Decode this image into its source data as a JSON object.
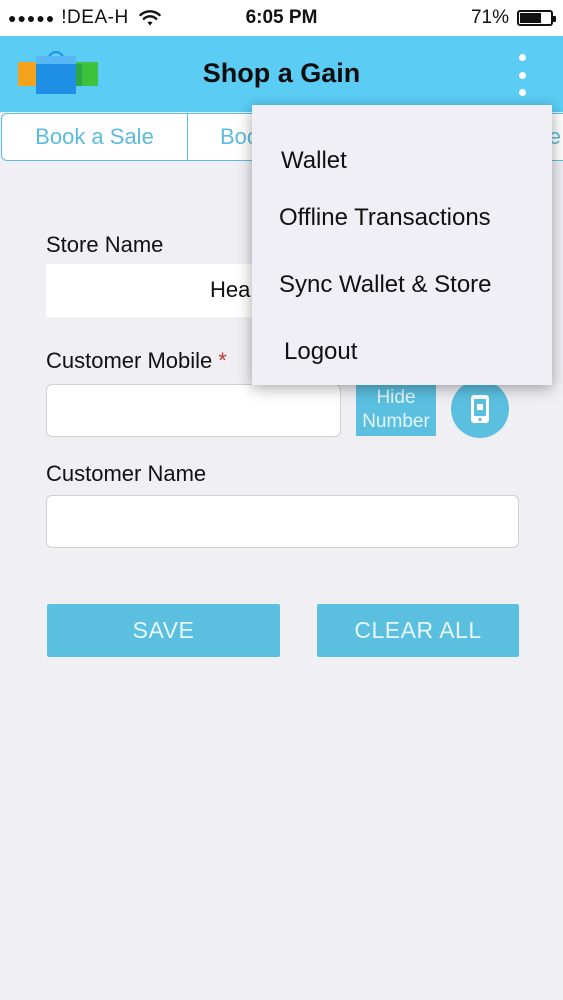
{
  "status_bar": {
    "signal_dots": "●●●●●",
    "carrier": "!DEA-H",
    "wifi_icon": "wifi-icon",
    "time": "6:05 PM",
    "battery_percent": "71%",
    "battery_level": 0.71
  },
  "app_bar": {
    "title": "Shop a Gain",
    "logo_icon": "shopping-bags-logo",
    "menu_icon": "more-vertical-icon"
  },
  "tabs": [
    {
      "label": "Book a Sale"
    },
    {
      "label": "Boo"
    },
    {
      "label": "e"
    }
  ],
  "form": {
    "store_name_label": "Store Name",
    "store_name_value": "Hea",
    "customer_mobile_label": "Customer Mobile",
    "required_mark": "*",
    "customer_mobile_value": "",
    "hide_number_label_line1": "Hide",
    "hide_number_label_line2": "Number",
    "contact_icon": "contact-phone-icon",
    "customer_name_label": "Customer Name",
    "customer_name_value": "",
    "save_label": "SAVE",
    "clear_all_label": "CLEAR ALL"
  },
  "overflow_menu": {
    "items": [
      {
        "label": "Wallet"
      },
      {
        "label": "Offline Transactions"
      },
      {
        "label": "Sync Wallet & Store"
      },
      {
        "label": "Logout"
      }
    ]
  },
  "colors": {
    "accent": "#5bc0e0",
    "app_bar": "#5bcdf5",
    "background": "#efeff4"
  }
}
